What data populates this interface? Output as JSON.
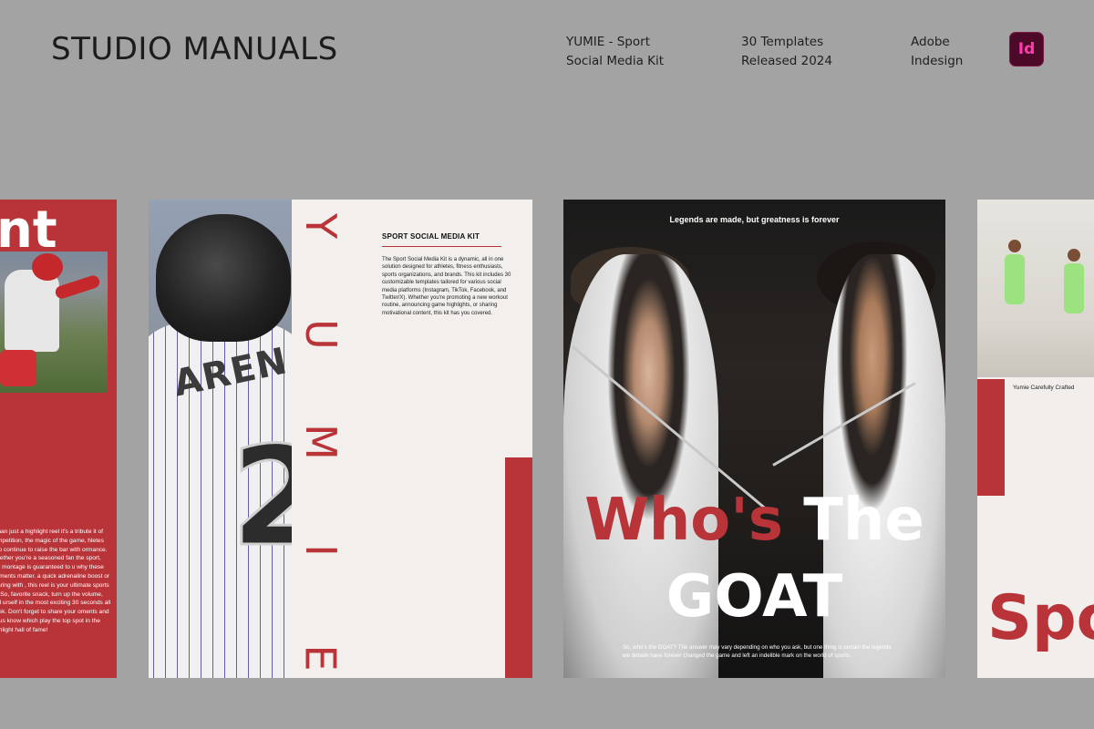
{
  "header": {
    "brand": "STUDIO MANUALS",
    "product_line1": "YUMIE - Sport",
    "product_line2": "Social Media Kit",
    "templates_line1": "30 Templates",
    "templates_line2": "Released 2024",
    "software_line1": "Adobe",
    "software_line2": "Indesign",
    "app_icon_label": "Id",
    "app_icon_name": "indesign-icon"
  },
  "colors": {
    "background": "#a3a3a3",
    "accent_red": "#b83439",
    "card_light": "#f2efed"
  },
  "card1": {
    "big_letters": "nt",
    "body": "e than just a highlight reel it's a tribute it of competition, the magic of the game, hletes who continue to raise the bar with ormance. Whether you're a seasoned fan the sport, this montage is guaranteed to u why these moments matter. a quick adrenaline boost or sharing with , this reel is your ultimate sports fix. So, favorite snack, turn up the volume, and urself in the most exciting 30 seconds all week. Don't forget to share your oments and let us know which play the top spot in the highlight hall of fame!"
  },
  "card2": {
    "jersey_name": "AREN",
    "jersey_number": "2",
    "vertical_letters": [
      "Y",
      "U",
      "M",
      "I",
      "E"
    ],
    "title": "SPORT SOCIAL MEDIA KIT",
    "body": "The Sport Social Media Kit is a dynamic, all in one solution designed for athletes, fitness enthusiasts, sports organizations, and brands. This kit includes 30 customizable templates tailored for various social media platforms (Instagram, TikTok, Facebook, and Twitter/X). Whether you're promoting a new workout routine, announcing game highlights, or sharing motivational content, this kit has you covered."
  },
  "card3": {
    "tagline": "Legends are made, but greatness is forever",
    "headline_red": "Who's",
    "headline_white": "The",
    "headline_line2": "GOAT",
    "footnote": "So, who's the GOAT? The answer may vary depending on who you ask, but one thing is certain the legends we debate have forever changed the game and left an indelible mark on the world of sports."
  },
  "card4": {
    "caption": "Yumie Carefully Crafted",
    "big_word": "Spo"
  }
}
